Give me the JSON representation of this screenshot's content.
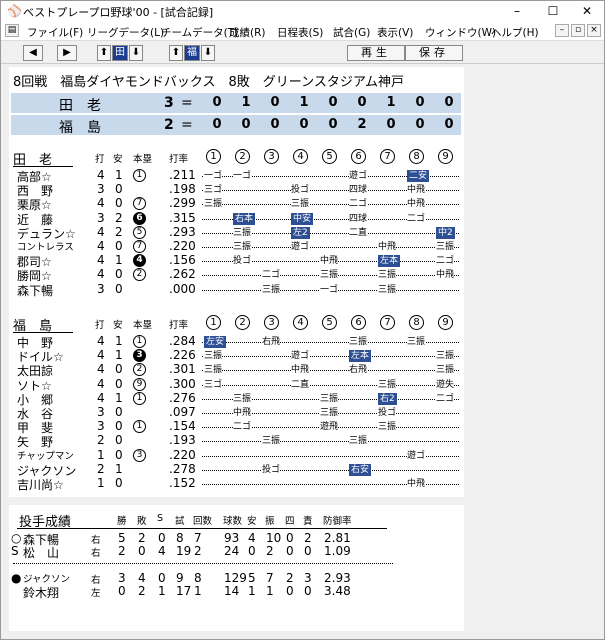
{
  "window": {
    "title": "ベストプレープロ野球'00 - [試合記録]"
  },
  "menu": [
    "ファイル(F)",
    "リーグデータ(L)",
    "チームデータ(T)",
    "成績(R)",
    "日程表(S)",
    "試合(G)",
    "表示(V)",
    "ウィンドウ(W)",
    "ヘルプ(H)"
  ],
  "toolbar": {
    "left": "◀",
    "right": "▶",
    "up1": "⬆",
    "team1": "田",
    "down1": "⬇",
    "up2": "⬆",
    "team2": "福",
    "down2": "⬇",
    "replay": "再生",
    "save": "保存"
  },
  "game": {
    "title": "8回戦　福島ダイヤモンドバックス　8敗　グリーンスタジアム神戸"
  },
  "line_score": [
    {
      "team": "田　老",
      "runs": "3",
      "eq": "=",
      "innings": [
        "0",
        "1",
        "0",
        "1",
        "0",
        "0",
        "1",
        "0",
        "0"
      ]
    },
    {
      "team": "福　島",
      "runs": "2",
      "eq": "=",
      "innings": [
        "0",
        "0",
        "0",
        "0",
        "0",
        "2",
        "0",
        "0",
        "0"
      ]
    }
  ],
  "bat_headers": {
    "ab": "打",
    "h": "安",
    "hr": "本塁",
    "avg": "打率"
  },
  "innings_headers": [
    "1",
    "2",
    "3",
    "4",
    "5",
    "6",
    "7",
    "8",
    "9"
  ],
  "team1": {
    "name": "田　老",
    "players": [
      {
        "name": "高部☆",
        "ab": "4",
        "h": "1",
        "hr": "1",
        "hr_filled": false,
        "avg": ".211"
      },
      {
        "name": "西　野",
        "ab": "3",
        "h": "0",
        "hr": "",
        "hr_filled": false,
        "avg": ".198"
      },
      {
        "name": "栗原☆",
        "ab": "4",
        "h": "0",
        "hr": "7",
        "hr_filled": false,
        "avg": ".299"
      },
      {
        "name": "近　藤",
        "ab": "3",
        "h": "2",
        "hr": "6",
        "hr_filled": true,
        "avg": ".315"
      },
      {
        "name": "デュラン☆",
        "ab": "4",
        "h": "2",
        "hr": "5",
        "hr_filled": false,
        "avg": ".293"
      },
      {
        "name": "コントレラス",
        "ab": "4",
        "h": "0",
        "hr": "7",
        "hr_filled": false,
        "avg": ".220"
      },
      {
        "name": "郡司☆",
        "ab": "4",
        "h": "1",
        "hr": "4",
        "hr_filled": true,
        "avg": ".156"
      },
      {
        "name": "勝岡☆",
        "ab": "4",
        "h": "0",
        "hr": "2",
        "hr_filled": false,
        "avg": ".262"
      },
      {
        "name": "森下暢",
        "ab": "3",
        "h": "0",
        "hr": "",
        "hr_filled": false,
        "avg": ".000"
      }
    ],
    "results": [
      [
        {
          "i": 1,
          "t": "一ゴ"
        },
        {
          "i": 2,
          "t": "一ゴ"
        },
        {
          "i": 6,
          "t": "遊ゴ"
        },
        {
          "i": 8,
          "t": "二安",
          "hl": true
        }
      ],
      [
        {
          "i": 1,
          "t": "三ゴ"
        },
        {
          "i": 4,
          "t": "投ゴ"
        },
        {
          "i": 6,
          "t": "四球"
        },
        {
          "i": 8,
          "t": "中飛"
        }
      ],
      [
        {
          "i": 1,
          "t": "三振"
        },
        {
          "i": 4,
          "t": "三振"
        },
        {
          "i": 6,
          "t": "二ゴ"
        },
        {
          "i": 8,
          "t": "中飛"
        }
      ],
      [
        {
          "i": 2,
          "t": "右本",
          "hl": true
        },
        {
          "i": 4,
          "t": "中安",
          "hl": true
        },
        {
          "i": 6,
          "t": "四球"
        },
        {
          "i": 8,
          "t": "二ゴ"
        }
      ],
      [
        {
          "i": 2,
          "t": "三振"
        },
        {
          "i": 4,
          "t": "左2",
          "hl": true
        },
        {
          "i": 6,
          "t": "二直"
        },
        {
          "i": 9,
          "t": "中2",
          "hl": true
        }
      ],
      [
        {
          "i": 2,
          "t": "三振"
        },
        {
          "i": 4,
          "t": "遊ゴ"
        },
        {
          "i": 7,
          "t": "中飛"
        },
        {
          "i": 9,
          "t": "三振"
        }
      ],
      [
        {
          "i": 2,
          "t": "投ゴ"
        },
        {
          "i": 5,
          "t": "中飛"
        },
        {
          "i": 7,
          "t": "左本",
          "hl": true
        },
        {
          "i": 9,
          "t": "二ゴ"
        }
      ],
      [
        {
          "i": 3,
          "t": "二ゴ"
        },
        {
          "i": 5,
          "t": "三振"
        },
        {
          "i": 7,
          "t": "三振"
        },
        {
          "i": 9,
          "t": "中飛"
        }
      ],
      [
        {
          "i": 3,
          "t": "三振"
        },
        {
          "i": 5,
          "t": "一ゴ"
        },
        {
          "i": 7,
          "t": "三振"
        }
      ]
    ]
  },
  "team2": {
    "name": "福　島",
    "players": [
      {
        "name": "中　野",
        "ab": "4",
        "h": "1",
        "hr": "1",
        "hr_filled": false,
        "avg": ".284"
      },
      {
        "name": "ドイル☆",
        "ab": "4",
        "h": "1",
        "hr": "3",
        "hr_filled": true,
        "avg": ".226"
      },
      {
        "name": "太田諒",
        "ab": "4",
        "h": "0",
        "hr": "2",
        "hr_filled": false,
        "avg": ".301"
      },
      {
        "name": "ソト☆",
        "ab": "4",
        "h": "0",
        "hr": "9",
        "hr_filled": false,
        "avg": ".300"
      },
      {
        "name": "小　郷",
        "ab": "4",
        "h": "1",
        "hr": "1",
        "hr_filled": false,
        "avg": ".276"
      },
      {
        "name": "水　谷",
        "ab": "3",
        "h": "0",
        "hr": "",
        "hr_filled": false,
        "avg": ".097"
      },
      {
        "name": "甲　斐",
        "ab": "3",
        "h": "0",
        "hr": "1",
        "hr_filled": false,
        "avg": ".154"
      },
      {
        "name": "矢　野",
        "ab": "2",
        "h": "0",
        "hr": "",
        "hr_filled": false,
        "avg": ".193"
      },
      {
        "name": "チャップマン",
        "ab": "1",
        "h": "0",
        "hr": "3",
        "hr_filled": false,
        "avg": ".220"
      },
      {
        "name": "ジャクソン",
        "ab": "2",
        "h": "1",
        "hr": "",
        "hr_filled": false,
        "avg": ".278"
      },
      {
        "name": "吉川尚☆",
        "ab": "1",
        "h": "0",
        "hr": "",
        "hr_filled": false,
        "avg": ".152"
      }
    ],
    "results": [
      [
        {
          "i": 1,
          "t": "左安",
          "hl": true
        },
        {
          "i": 3,
          "t": "右飛"
        },
        {
          "i": 6,
          "t": "三振"
        },
        {
          "i": 8,
          "t": "三振"
        }
      ],
      [
        {
          "i": 1,
          "t": "三振"
        },
        {
          "i": 4,
          "t": "遊ゴ"
        },
        {
          "i": 6,
          "t": "左本",
          "hl": true
        },
        {
          "i": 9,
          "t": "三振"
        }
      ],
      [
        {
          "i": 1,
          "t": "三振"
        },
        {
          "i": 4,
          "t": "中飛"
        },
        {
          "i": 6,
          "t": "右飛"
        },
        {
          "i": 9,
          "t": "三振"
        }
      ],
      [
        {
          "i": 1,
          "t": "三ゴ"
        },
        {
          "i": 4,
          "t": "二直"
        },
        {
          "i": 7,
          "t": "三振"
        },
        {
          "i": 9,
          "t": "遊失"
        }
      ],
      [
        {
          "i": 2,
          "t": "三振"
        },
        {
          "i": 5,
          "t": "三振"
        },
        {
          "i": 7,
          "t": "右2",
          "hl": true
        },
        {
          "i": 9,
          "t": "二ゴ"
        }
      ],
      [
        {
          "i": 2,
          "t": "中飛"
        },
        {
          "i": 5,
          "t": "三振"
        },
        {
          "i": 7,
          "t": "投ゴ"
        }
      ],
      [
        {
          "i": 2,
          "t": "二ゴ"
        },
        {
          "i": 5,
          "t": "遊飛"
        },
        {
          "i": 7,
          "t": "三振"
        }
      ],
      [
        {
          "i": 3,
          "t": "三振"
        },
        {
          "i": 6,
          "t": "三振"
        }
      ],
      [
        {
          "i": 8,
          "t": "遊ゴ"
        }
      ],
      [
        {
          "i": 3,
          "t": "投ゴ"
        },
        {
          "i": 6,
          "t": "右安",
          "hl": true
        }
      ],
      [
        {
          "i": 8,
          "t": "中飛"
        }
      ]
    ]
  },
  "pitching": {
    "title": "投手成績",
    "headers": [
      "勝",
      "敗",
      "S",
      "試",
      "回数",
      "球数",
      "安",
      "振",
      "四",
      "責",
      "防御率"
    ],
    "team1": [
      {
        "mark": "○",
        "name": "森下暢",
        "hand": "右",
        "w": "5",
        "l": "2",
        "s": "0",
        "g": "8",
        "ip": "7",
        "np": "93",
        "h": "4",
        "k": "10",
        "bb": "0",
        "er": "2",
        "era": "2.81"
      },
      {
        "mark": "S",
        "name": "松　山",
        "hand": "右",
        "w": "2",
        "l": "0",
        "s": "4",
        "g": "19",
        "ip": "2",
        "np": "24",
        "h": "0",
        "k": "2",
        "bb": "0",
        "er": "0",
        "era": "1.09"
      }
    ],
    "team2": [
      {
        "mark": "●",
        "name": "ジャクソン",
        "hand": "右",
        "w": "3",
        "l": "4",
        "s": "0",
        "g": "9",
        "ip": "8",
        "np": "129",
        "h": "5",
        "k": "7",
        "bb": "2",
        "er": "3",
        "era": "2.93"
      },
      {
        "mark": "",
        "name": "鈴木翔",
        "hand": "左",
        "w": "0",
        "l": "2",
        "s": "1",
        "g": "17",
        "ip": "1",
        "np": "14",
        "h": "1",
        "k": "1",
        "bb": "0",
        "er": "0",
        "era": "3.48"
      }
    ]
  }
}
